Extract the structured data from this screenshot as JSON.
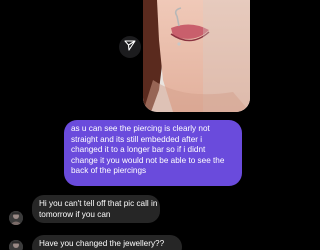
{
  "conversation": {
    "shared_photo": {
      "description_icon": "photo-of-lip-piercing"
    },
    "share_icon": "paper-plane-icon",
    "messages": [
      {
        "sender": "me",
        "lines": [
          "as u can see the piercing is clearly not",
          "straight and its still embedded after i",
          "changed it to a longer bar so if i didnt",
          "change it you would not be able to see the",
          "back of the piercings"
        ]
      },
      {
        "sender": "other",
        "lines": [
          "Hi you can't tell off that pic call in",
          "tomorrow if you can"
        ]
      },
      {
        "sender": "other",
        "lines": [
          "Have you changed the jewellery??"
        ]
      }
    ],
    "colors": {
      "background": "#000000",
      "outgoing_bubble": "#6a4bdc",
      "incoming_bubble": "#262626",
      "text": "#ffffff"
    }
  }
}
